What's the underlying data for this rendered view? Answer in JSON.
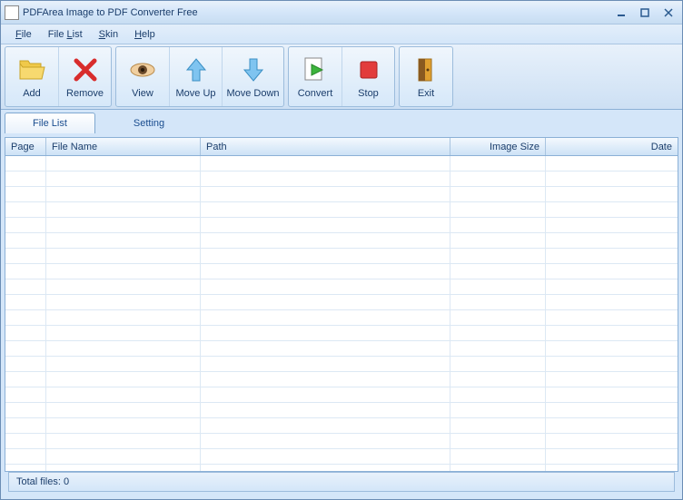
{
  "window": {
    "title": "PDFArea Image to PDF Converter Free"
  },
  "menu": {
    "file": "File",
    "filelist": "File List",
    "skin": "Skin",
    "help": "Help"
  },
  "toolbar": {
    "add": "Add",
    "remove": "Remove",
    "view": "View",
    "moveup": "Move Up",
    "movedown": "Move Down",
    "convert": "Convert",
    "stop": "Stop",
    "exit": "Exit"
  },
  "tabs": {
    "filelist": "File List",
    "setting": "Setting"
  },
  "columns": {
    "page": "Page",
    "filename": "File Name",
    "path": "Path",
    "imagesize": "Image Size",
    "date": "Date"
  },
  "status": {
    "text": "Total files: 0"
  }
}
